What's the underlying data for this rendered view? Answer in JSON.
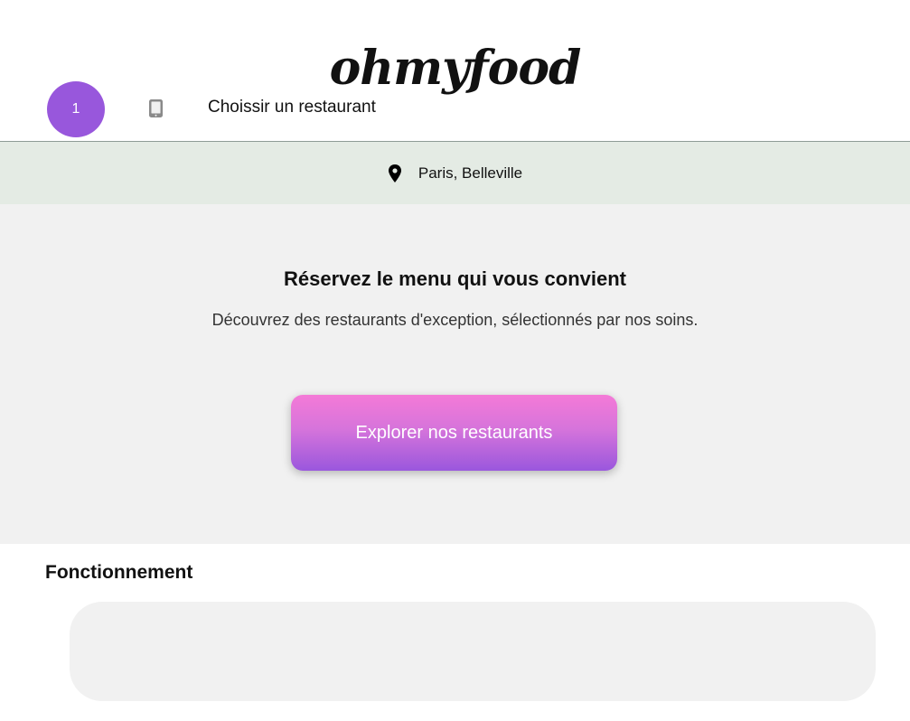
{
  "header": {
    "logo": "ohmyfood"
  },
  "location": {
    "icon": "map-pin-icon",
    "text": "Paris, Belleville"
  },
  "hero": {
    "title": "Réservez le menu qui vous convient",
    "subtitle": "Découvrez des restaurants d'exception, sélectionnés par nos soins.",
    "cta_label": "Explorer nos restaurants"
  },
  "how_it_works": {
    "title": "Fonctionnement",
    "steps": [
      {
        "number": "1",
        "icon": "mobile-phone-icon",
        "label": "Choissir un restaurant"
      }
    ]
  },
  "colors": {
    "accent_purple": "#9857dc",
    "accent_pink": "#f47ad7",
    "location_bar": "#e4ebe4",
    "section_bg": "#f1f1f1"
  }
}
